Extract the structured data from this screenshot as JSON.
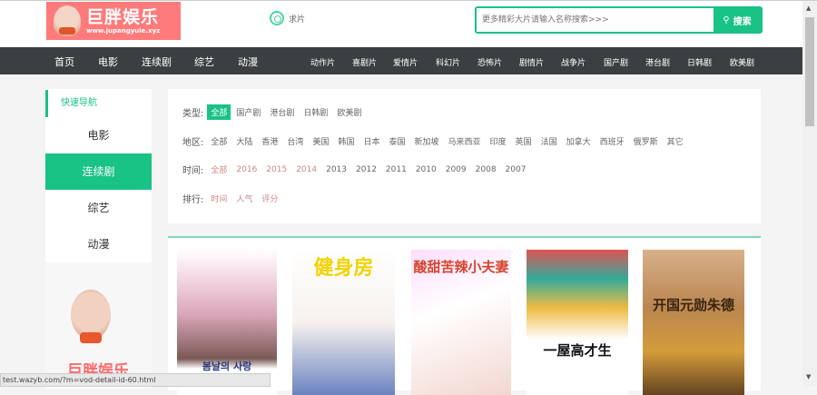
{
  "header": {
    "logo_title": "巨胖娱乐",
    "logo_url": "www.jupangyule.xyz",
    "request_link": "求片",
    "search_placeholder": "更多精彩大片请输入名称搜索>>>",
    "search_button": "搜索"
  },
  "nav": {
    "main": [
      "首页",
      "电影",
      "连续剧",
      "综艺",
      "动漫"
    ],
    "genres": [
      "动作片",
      "喜剧片",
      "爱情片",
      "科幻片",
      "恐怖片",
      "剧情片",
      "战争片",
      "国产剧",
      "港台剧",
      "日韩剧",
      "欧美剧"
    ]
  },
  "sidebar": {
    "title": "快速导航",
    "items": [
      "电影",
      "连续剧",
      "综艺",
      "动漫"
    ],
    "active": "连续剧",
    "promo_brand": "巨胖娱乐"
  },
  "filters": {
    "type": {
      "label": "类型:",
      "options": [
        "全部",
        "国产剧",
        "港台剧",
        "日韩剧",
        "欧美剧"
      ]
    },
    "area": {
      "label": "地区:",
      "options": [
        "全部",
        "大陆",
        "香港",
        "台湾",
        "美国",
        "韩国",
        "日本",
        "泰国",
        "新加坡",
        "马来西亚",
        "印度",
        "英国",
        "法国",
        "加拿大",
        "西班牙",
        "俄罗斯",
        "其它"
      ]
    },
    "year": {
      "label": "时间:",
      "options": [
        "全部",
        "2016",
        "2015",
        "2014",
        "2013",
        "2012",
        "2011",
        "2010",
        "2009",
        "2008",
        "2007"
      ]
    },
    "sort": {
      "label": "排行:",
      "options": [
        "时间",
        "人气",
        "评分"
      ]
    }
  },
  "posters": [
    {
      "title": "봄날의 사랑"
    },
    {
      "title": "健身房"
    },
    {
      "title": "酸甜苦辣小夫妻"
    },
    {
      "title": "一屋高才生"
    },
    {
      "title": "开国元勋朱德"
    }
  ],
  "status_url": "test.wazyb.com/?m=vod-detail-id-60.html",
  "colors": {
    "accent": "#19c285",
    "nav": "#3b3f42",
    "logo_bg": "#ff7a7a"
  }
}
